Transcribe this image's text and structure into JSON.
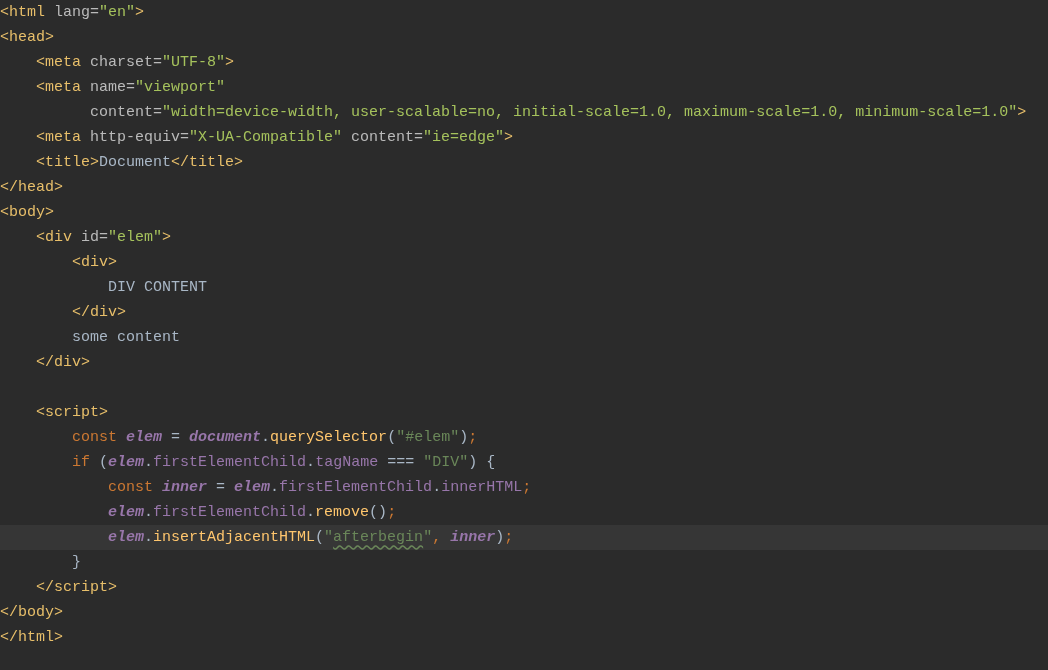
{
  "editor": {
    "lines": [
      {
        "kind": "code",
        "tokens": [
          {
            "kind": "tag",
            "text": "<html"
          },
          {
            "kind": "attr",
            "text": " lang="
          },
          {
            "kind": "str",
            "text": "\"en\""
          },
          {
            "kind": "tag",
            "text": ">"
          }
        ]
      },
      {
        "kind": "code",
        "tokens": [
          {
            "kind": "tag",
            "text": "<head>"
          }
        ]
      },
      {
        "kind": "code",
        "tokens": [
          {
            "kind": "tag",
            "text": "    <meta"
          },
          {
            "kind": "attr",
            "text": " charset="
          },
          {
            "kind": "str",
            "text": "\"UTF-8\""
          },
          {
            "kind": "tag",
            "text": ">"
          }
        ]
      },
      {
        "kind": "code",
        "tokens": [
          {
            "kind": "tag",
            "text": "    <meta"
          },
          {
            "kind": "attr",
            "text": " name="
          },
          {
            "kind": "str",
            "text": "\"viewport\""
          }
        ]
      },
      {
        "kind": "code",
        "tokens": [
          {
            "kind": "attr",
            "text": "          content="
          },
          {
            "kind": "str",
            "text": "\"width=device-width, user-scalable=no, initial-scale=1.0, maximum-scale=1.0, minimum-scale=1.0\""
          },
          {
            "kind": "tag",
            "text": ">"
          }
        ]
      },
      {
        "kind": "code",
        "tokens": [
          {
            "kind": "tag",
            "text": "    <meta"
          },
          {
            "kind": "attr",
            "text": " http-equiv="
          },
          {
            "kind": "str",
            "text": "\"X-UA-Compatible\""
          },
          {
            "kind": "attr",
            "text": " content="
          },
          {
            "kind": "str",
            "text": "\"ie=edge\""
          },
          {
            "kind": "tag",
            "text": ">"
          }
        ]
      },
      {
        "kind": "code",
        "tokens": [
          {
            "kind": "tag",
            "text": "    <title>"
          },
          {
            "kind": "text",
            "text": "Document"
          },
          {
            "kind": "tag",
            "text": "</title>"
          }
        ]
      },
      {
        "kind": "code",
        "tokens": [
          {
            "kind": "tag",
            "text": "</head>"
          }
        ]
      },
      {
        "kind": "code",
        "tokens": [
          {
            "kind": "tag",
            "text": "<body>"
          }
        ]
      },
      {
        "kind": "code",
        "tokens": [
          {
            "kind": "tag",
            "text": "    <div"
          },
          {
            "kind": "attr",
            "text": " id="
          },
          {
            "kind": "str",
            "text": "\"elem\""
          },
          {
            "kind": "tag",
            "text": ">"
          }
        ]
      },
      {
        "kind": "code",
        "tokens": [
          {
            "kind": "tag",
            "text": "        <div>"
          }
        ]
      },
      {
        "kind": "code",
        "tokens": [
          {
            "kind": "text",
            "text": "            DIV CONTENT"
          }
        ]
      },
      {
        "kind": "code",
        "tokens": [
          {
            "kind": "tag",
            "text": "        </div>"
          }
        ]
      },
      {
        "kind": "code",
        "tokens": [
          {
            "kind": "text",
            "text": "        some content"
          }
        ]
      },
      {
        "kind": "code",
        "tokens": [
          {
            "kind": "tag",
            "text": "    </div>"
          }
        ]
      },
      {
        "kind": "blank"
      },
      {
        "kind": "code",
        "tokens": [
          {
            "kind": "tag",
            "text": "    <script>"
          }
        ]
      },
      {
        "kind": "code",
        "tokens": [
          {
            "kind": "keyword",
            "text": "        const "
          },
          {
            "kind": "var",
            "text": "elem"
          },
          {
            "kind": "punct",
            "text": " = "
          },
          {
            "kind": "var",
            "text": "document"
          },
          {
            "kind": "punct",
            "text": "."
          },
          {
            "kind": "method",
            "text": "querySelector"
          },
          {
            "kind": "punct",
            "text": "("
          },
          {
            "kind": "jsstr",
            "text": "\"#elem\""
          },
          {
            "kind": "punct",
            "text": ")"
          },
          {
            "kind": "keyword",
            "text": ";"
          }
        ]
      },
      {
        "kind": "code",
        "tokens": [
          {
            "kind": "keyword",
            "text": "        if "
          },
          {
            "kind": "punct",
            "text": "("
          },
          {
            "kind": "var",
            "text": "elem"
          },
          {
            "kind": "punct",
            "text": "."
          },
          {
            "kind": "field",
            "text": "firstElementChild"
          },
          {
            "kind": "punct",
            "text": "."
          },
          {
            "kind": "field",
            "text": "tagName"
          },
          {
            "kind": "punct",
            "text": " === "
          },
          {
            "kind": "jsstr",
            "text": "\"DIV\""
          },
          {
            "kind": "punct",
            "text": ") {"
          }
        ]
      },
      {
        "kind": "code",
        "tokens": [
          {
            "kind": "keyword",
            "text": "            const "
          },
          {
            "kind": "var",
            "text": "inner"
          },
          {
            "kind": "punct",
            "text": " = "
          },
          {
            "kind": "var",
            "text": "elem"
          },
          {
            "kind": "punct",
            "text": "."
          },
          {
            "kind": "field",
            "text": "firstElementChild"
          },
          {
            "kind": "punct",
            "text": "."
          },
          {
            "kind": "field",
            "text": "innerHTML"
          },
          {
            "kind": "keyword",
            "text": ";"
          }
        ]
      },
      {
        "kind": "code",
        "tokens": [
          {
            "kind": "var",
            "text": "            elem"
          },
          {
            "kind": "punct",
            "text": "."
          },
          {
            "kind": "field",
            "text": "firstElementChild"
          },
          {
            "kind": "punct",
            "text": "."
          },
          {
            "kind": "method",
            "text": "remove"
          },
          {
            "kind": "punct",
            "text": "()"
          },
          {
            "kind": "keyword",
            "text": ";"
          }
        ]
      },
      {
        "kind": "code",
        "current": true,
        "tokens": [
          {
            "kind": "var",
            "text": "            elem"
          },
          {
            "kind": "punct",
            "text": "."
          },
          {
            "kind": "method",
            "text": "insertAdjacentHTML"
          },
          {
            "kind": "punct",
            "text": "("
          },
          {
            "kind": "jsstr",
            "text": "\""
          },
          {
            "kind": "typo",
            "text": "afterbegin"
          },
          {
            "kind": "jsstr",
            "text": "\""
          },
          {
            "kind": "keyword",
            "text": ", "
          },
          {
            "kind": "var",
            "text": "inner"
          },
          {
            "kind": "punct",
            "text": ")"
          },
          {
            "kind": "keyword",
            "text": ";"
          }
        ]
      },
      {
        "kind": "code",
        "tokens": [
          {
            "kind": "punct",
            "text": "        }"
          }
        ]
      },
      {
        "kind": "code",
        "tokens": [
          {
            "kind": "tag",
            "text": "    </script>"
          }
        ]
      },
      {
        "kind": "code",
        "tokens": [
          {
            "kind": "tag",
            "text": "</body>"
          }
        ]
      },
      {
        "kind": "code",
        "tokens": [
          {
            "kind": "tag",
            "text": "</html>"
          }
        ]
      }
    ]
  }
}
